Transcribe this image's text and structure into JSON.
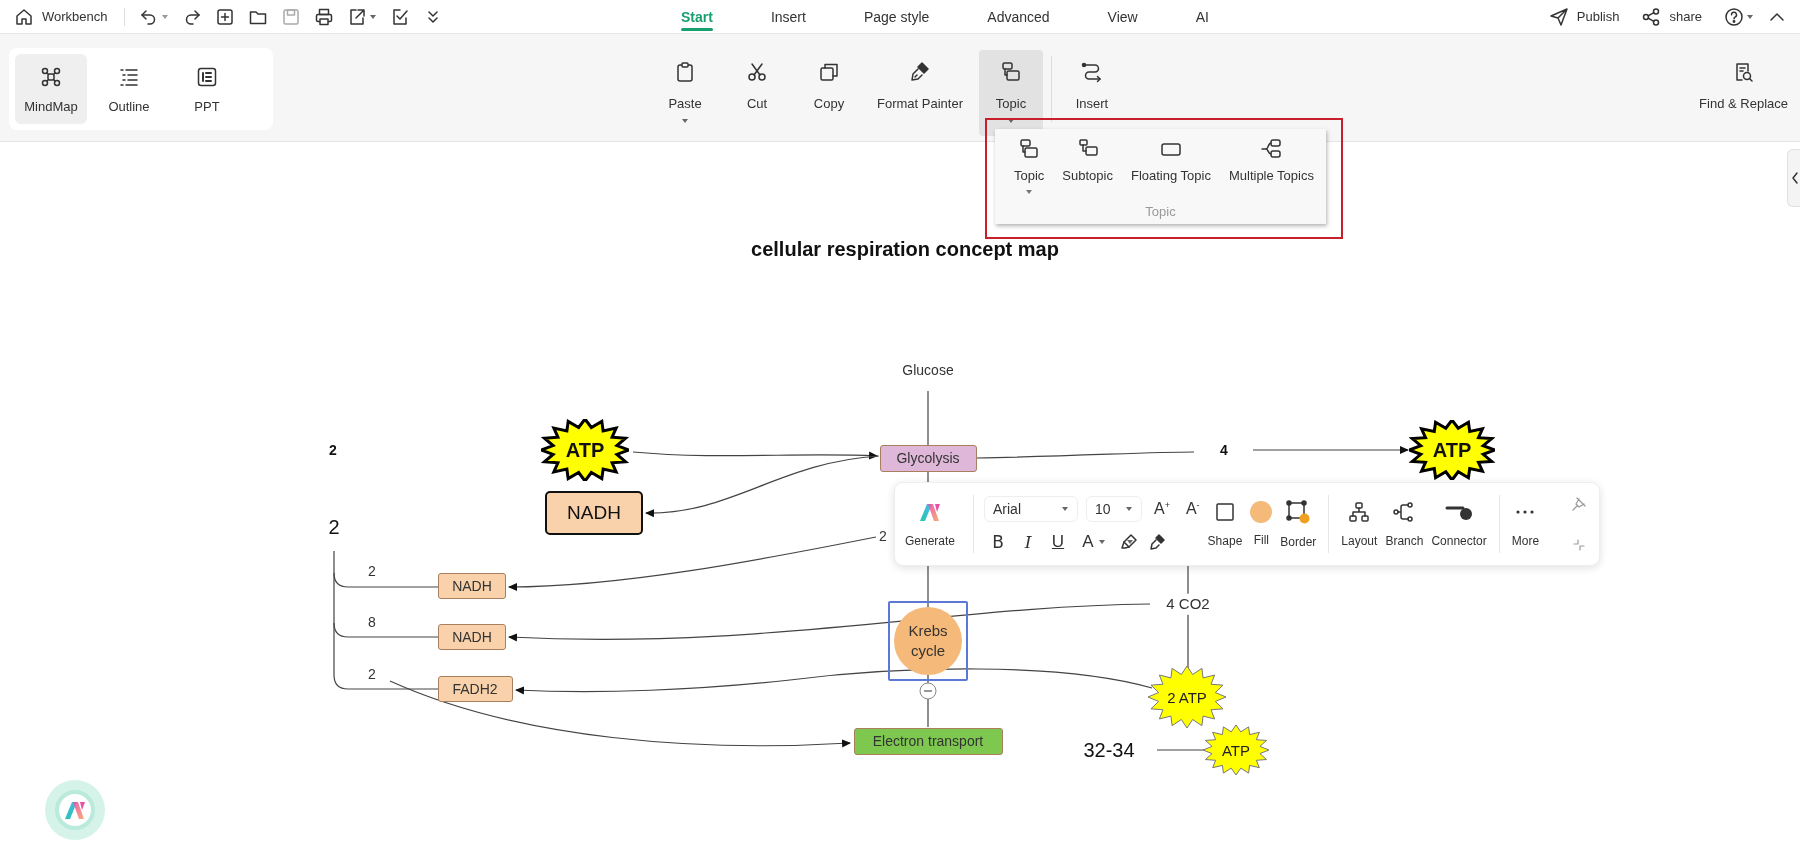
{
  "top_bar": {
    "home": "Workbench",
    "tabs": [
      {
        "label": "Start",
        "selected": true
      },
      {
        "label": "Insert",
        "selected": false
      },
      {
        "label": "Page style",
        "selected": false
      },
      {
        "label": "Advanced",
        "selected": false
      },
      {
        "label": "View",
        "selected": false
      },
      {
        "label": "AI",
        "selected": false
      }
    ],
    "actions": [
      {
        "kind": "publish",
        "label": "Publish"
      },
      {
        "kind": "share",
        "label": "share"
      }
    ]
  },
  "view_modes": [
    {
      "kind": "mindmap",
      "label": "MindMap",
      "selected": true
    },
    {
      "kind": "outline",
      "label": "Outline",
      "selected": false
    },
    {
      "kind": "ppt",
      "label": "PPT",
      "selected": false
    }
  ],
  "ribbon": [
    {
      "kind": "paste",
      "label": "Paste",
      "active": false
    },
    {
      "kind": "cut",
      "label": "Cut",
      "active": false
    },
    {
      "kind": "copy",
      "label": "Copy",
      "active": false
    },
    {
      "kind": "painter",
      "label": "Format Painter",
      "active": false
    },
    {
      "kind": "topic",
      "label": "Topic",
      "active": true
    },
    {
      "kind": "insert",
      "label": "Insert",
      "active": false
    }
  ],
  "find_replace": "Find & Replace",
  "topic_menu": {
    "items": [
      {
        "kind": "topic",
        "label": "Topic"
      },
      {
        "kind": "subtopic",
        "label": "Subtopic"
      },
      {
        "kind": "floating",
        "label": "Floating Topic"
      },
      {
        "kind": "multiple",
        "label": "Multiple Topics"
      }
    ],
    "group": "Topic"
  },
  "map": {
    "title": "cellular respiration concept map",
    "nodes": [
      {
        "kind": "label",
        "text": "Glucose",
        "selected": false
      },
      {
        "kind": "label",
        "text": "2",
        "selected": false
      },
      {
        "kind": "star",
        "text": "ATP",
        "color": "#ffff00",
        "selected": false
      },
      {
        "kind": "box",
        "text": "Glycolysis",
        "color": "#dfb8d9",
        "selected": false
      },
      {
        "kind": "label",
        "text": "4",
        "selected": false
      },
      {
        "kind": "star",
        "text": "ATP",
        "color": "#ffff00",
        "selected": false
      },
      {
        "kind": "box",
        "text": "NADH",
        "color": "#f9d2ab",
        "selected": false
      },
      {
        "kind": "label",
        "text": "2",
        "selected": false
      },
      {
        "kind": "label",
        "text": "2",
        "selected": false
      },
      {
        "kind": "label",
        "text": "2",
        "selected": false
      },
      {
        "kind": "box",
        "text": "NADH",
        "color": "#f9d2ab",
        "selected": false
      },
      {
        "kind": "label",
        "text": "4 CO2",
        "selected": false
      },
      {
        "kind": "label",
        "text": "8",
        "selected": false
      },
      {
        "kind": "box",
        "text": "NADH",
        "color": "#f9d2ab",
        "selected": false
      },
      {
        "kind": "circle",
        "text": "Krebs cycle",
        "color": "#f5b97a",
        "selected": true
      },
      {
        "kind": "label",
        "text": "2",
        "selected": false
      },
      {
        "kind": "box",
        "text": "FADH2",
        "color": "#f9d2ab",
        "selected": false
      },
      {
        "kind": "star",
        "text": "2 ATP",
        "color": "#ffff00",
        "selected": false
      },
      {
        "kind": "box",
        "text": "Electron transport",
        "color": "#7ec850",
        "selected": false
      },
      {
        "kind": "label",
        "text": "32-34",
        "selected": false
      },
      {
        "kind": "star",
        "text": "ATP",
        "color": "#ffff00",
        "selected": false
      }
    ]
  },
  "format_toolbar": {
    "generate": "Generate",
    "font": "Arial",
    "size": "10",
    "grow": "A$^{+}$",
    "shrink": "A$^{-}$",
    "text_styles": [
      {
        "kind": "bold",
        "label": "B"
      },
      {
        "kind": "italic",
        "label": "I"
      },
      {
        "kind": "underline",
        "label": "U"
      },
      {
        "kind": "color",
        "label": "A"
      }
    ],
    "tools": [
      {
        "kind": "shape",
        "label": "Shape"
      },
      {
        "kind": "fill",
        "label": "Fill",
        "color": "#f5b97a"
      },
      {
        "kind": "border",
        "label": "Border"
      },
      {
        "kind": "layout",
        "label": "Layout"
      },
      {
        "kind": "branch",
        "label": "Branch"
      },
      {
        "kind": "connector",
        "label": "Connector"
      },
      {
        "kind": "more",
        "label": "More"
      }
    ]
  }
}
